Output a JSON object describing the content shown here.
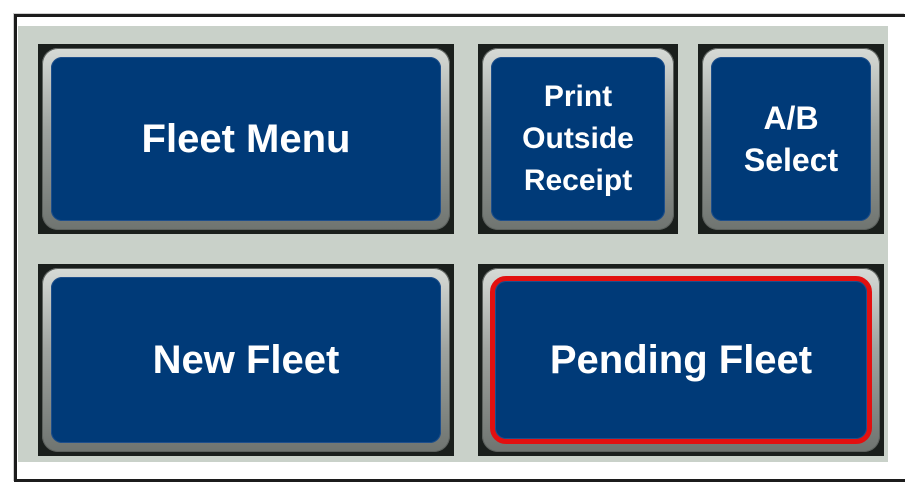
{
  "buttons": {
    "fleet_menu": "Fleet Menu",
    "print_outside_receipt": [
      "Print",
      "Outside",
      "Receipt"
    ],
    "ab_select": [
      "A/B",
      "Select"
    ],
    "new_fleet": "New Fleet",
    "pending_fleet": "Pending Fleet"
  },
  "colors": {
    "button_face": "#003a78",
    "panel_background": "#c9d1c9",
    "selection_outline": "#e21010"
  },
  "selected_button": "Pending Fleet"
}
